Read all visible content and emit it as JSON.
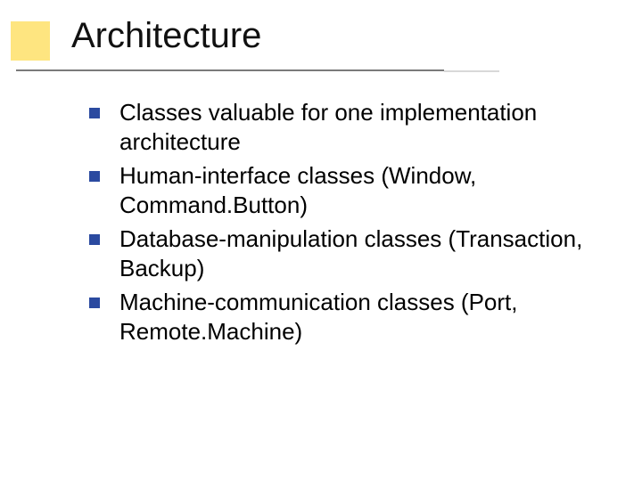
{
  "slide": {
    "title": "Architecture",
    "bullets": [
      "Classes valuable for one implementation architecture",
      "Human-interface classes (Window, Command.Button)",
      "Database-manipulation classes (Transaction, Backup)",
      "Machine-communication classes (Port, Remote.Machine)"
    ]
  }
}
